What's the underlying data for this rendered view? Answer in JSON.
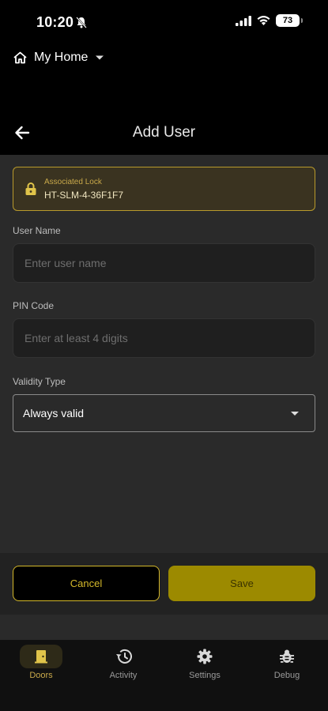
{
  "status_bar": {
    "time": "10:20",
    "battery": "73"
  },
  "home": {
    "label": "My Home"
  },
  "header": {
    "title": "Add User"
  },
  "lock_card": {
    "caption": "Associated Lock",
    "value": "HT-SLM-4-36F1F7"
  },
  "form": {
    "user_name_label": "User Name",
    "user_name_placeholder": "Enter user name",
    "pin_label": "PIN Code",
    "pin_placeholder": "Enter at least 4 digits",
    "validity_label": "Validity Type",
    "validity_value": "Always valid"
  },
  "actions": {
    "cancel": "Cancel",
    "save": "Save"
  },
  "bottom_nav": {
    "items": [
      {
        "label": "Doors",
        "icon": "door-icon",
        "active": true
      },
      {
        "label": "Activity",
        "icon": "history-icon",
        "active": false
      },
      {
        "label": "Settings",
        "icon": "gear-icon",
        "active": false
      },
      {
        "label": "Debug",
        "icon": "bug-icon",
        "active": false
      }
    ]
  },
  "colors": {
    "accent": "#d4b82a",
    "save_button": "#9c8a00",
    "background": "#2a2a2a"
  }
}
